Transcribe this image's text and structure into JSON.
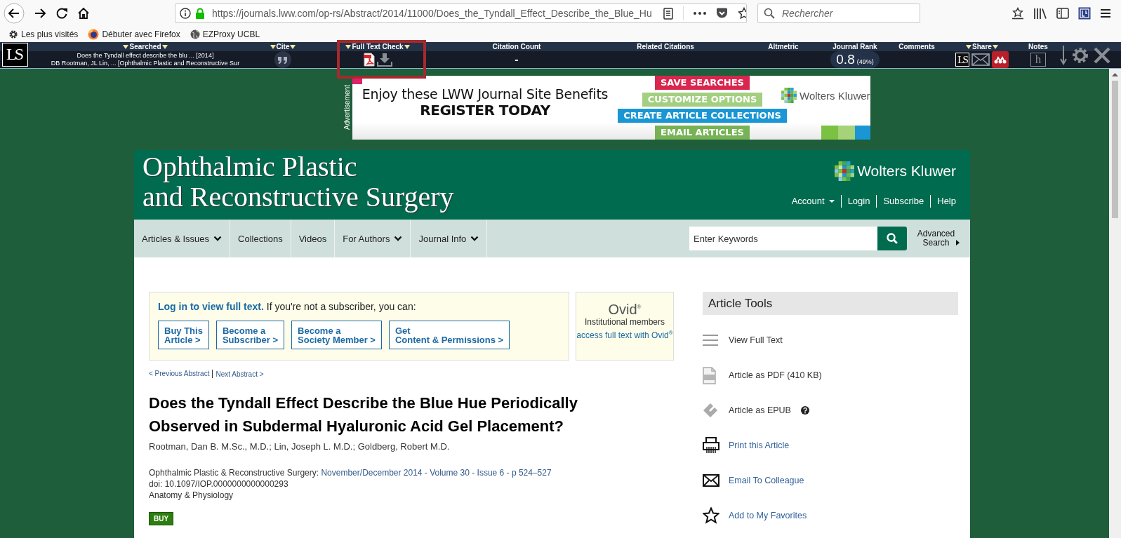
{
  "browser": {
    "url": "https://journals.lww.com/op-rs/Abstract/2014/11000/Does_the_Tyndall_Effect_Describe_the_Blue_Hu",
    "search_placeholder": "Rechercher",
    "bookmarks": [
      {
        "kind": "gear",
        "label": "Les plus visités"
      },
      {
        "kind": "firefox",
        "label": "Débuter avec Firefox"
      },
      {
        "kind": "globe",
        "label": "EZProxy UCBL"
      }
    ]
  },
  "ls_toolbar": {
    "logo": "LS",
    "columns": [
      {
        "kind": "searched",
        "label": "Searched",
        "dropdown": true,
        "lines": [
          "Does the Tyndall effect describe the blu ... [2014]",
          "DB Rootman, JL Lin, ... [Ophthalmic Plastic and Reconstructive Sur"
        ]
      },
      {
        "kind": "cite",
        "label": "Cite",
        "dropdown": true
      },
      {
        "kind": "fulltext",
        "label": "Full Text Check",
        "dropdown": true,
        "highlighted": true
      },
      {
        "kind": "count",
        "label": "Citation Count",
        "dropdown": false,
        "value": "-"
      },
      {
        "kind": "empty",
        "label": "Related Citations",
        "dropdown": false
      },
      {
        "kind": "empty",
        "label": "Altmetric",
        "dropdown": false
      },
      {
        "kind": "rank",
        "label": "Journal Rank",
        "dropdown": false,
        "value": "0.8",
        "percent": "(49%)"
      },
      {
        "kind": "empty",
        "label": "Comments",
        "dropdown": false
      },
      {
        "kind": "share",
        "label": "Share",
        "dropdown": true,
        "logo": "LS"
      },
      {
        "kind": "notes",
        "label": "Notes",
        "dropdown": false,
        "logo": "h"
      }
    ]
  },
  "advertisement": {
    "label": "Advertisement",
    "headline": "Enjoy these LWW Journal Site Benefits",
    "cta": "REGISTER TODAY",
    "benefits": [
      {
        "label": "SAVE SEARCHES",
        "color": "#d8264f"
      },
      {
        "label": "CUSTOMIZE OPTIONS",
        "color": "#a3cf80"
      },
      {
        "label": "CREATE ARTICLE COLLECTIONS",
        "color": "#1a96d4"
      },
      {
        "label": "EMAIL ARTICLES",
        "color": "#77b356"
      }
    ],
    "logo": "Wolters Kluwer"
  },
  "journal_header": {
    "title_lines": [
      "Ophthalmic Plastic",
      "and Reconstructive Surgery"
    ],
    "publisher": "Wolters Kluwer",
    "links": [
      {
        "label": "Account",
        "dropdown": true
      },
      {
        "label": "Login",
        "dropdown": false
      },
      {
        "label": "Subscribe",
        "dropdown": false
      },
      {
        "label": "Help",
        "dropdown": false
      }
    ]
  },
  "journal_nav": {
    "items": [
      {
        "label": "Articles & Issues",
        "dropdown": true
      },
      {
        "label": "Collections",
        "dropdown": false
      },
      {
        "label": "Videos",
        "dropdown": false
      },
      {
        "label": "For Authors",
        "dropdown": true
      },
      {
        "label": "Journal Info",
        "dropdown": true
      }
    ],
    "search_placeholder": "Enter Keywords",
    "advanced_search": [
      "Advanced",
      "Search"
    ]
  },
  "access": {
    "login_link": "Log in to view full text.",
    "prompt": " If you're not a subscriber, you can:",
    "options": [
      {
        "lines": [
          "Buy This",
          "Article >"
        ]
      },
      {
        "lines": [
          "Become a",
          "Subscriber >"
        ]
      },
      {
        "lines": [
          "Become a",
          "Society Member >"
        ]
      },
      {
        "lines": [
          "Get",
          "Content & Permissions >"
        ]
      }
    ]
  },
  "ovid": {
    "logo": "Ovid$^{®}$",
    "text": "Institutional members",
    "link": "access full text with Ovid$^{®}$"
  },
  "article_nav": {
    "previous": "< Previous Abstract",
    "next": "Next Abstract >"
  },
  "article": {
    "title": "Does the Tyndall Effect Describe the Blue Hue Periodically Observed in Subdermal Hyaluronic Acid Gel Placement?",
    "authors": "Rootman, Dan B. M.Sc., M.D.; Lin, Joseph L. M.D.; Goldberg, Robert M.D.",
    "journal": "Ophthalmic Plastic & Reconstructive Surgery: ",
    "issue": "November/December 2014 - Volume 30 - Issue 6 - p 524–527",
    "doi": "doi: 10.1097/IOP.0000000000000293",
    "subject": "Anatomy & Physiology",
    "buy": "BUY"
  },
  "article_tools": {
    "title": "Article Tools",
    "items": [
      {
        "kind": "fulltext",
        "label": "View Full Text",
        "linked": false,
        "help": false
      },
      {
        "kind": "pdf",
        "label": "Article as PDF (410 KB)",
        "linked": false,
        "help": false
      },
      {
        "kind": "epub",
        "label": "Article as EPUB",
        "linked": false,
        "help": true
      },
      {
        "kind": "print",
        "label": "Print this Article",
        "linked": true,
        "help": false
      },
      {
        "kind": "email",
        "label": "Email To Colleague",
        "linked": true,
        "help": false
      },
      {
        "kind": "favorite",
        "label": "Add to My Favorites",
        "linked": true,
        "help": false
      }
    ]
  }
}
